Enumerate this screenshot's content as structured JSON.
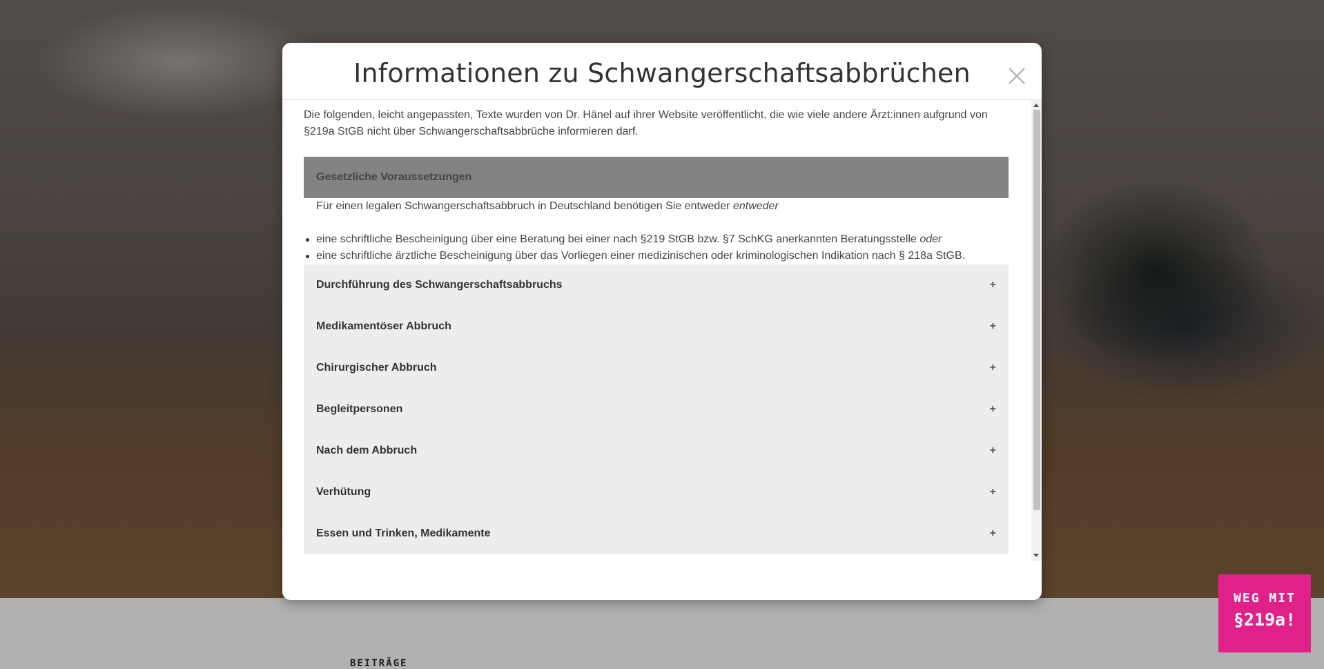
{
  "modal": {
    "title": "Informationen zu Schwangerschaftsabbrüchen",
    "intro": "Die folgenden, leicht angepassten, Texte wurden von Dr. Hänel auf ihrer Website veröffentlicht, die wie viele andere Ärzt:innen aufgrund von §219a StGB nicht über Schwangerschaftsabbrüche informieren darf.",
    "open_section": {
      "title": "Gesetzliche Voraussetzungen",
      "toggle": "–",
      "text": "Für einen legalen Schwangerschaftsabbruch in Deutschland benötigen Sie entweder",
      "text_em": "entweder",
      "bullets": [
        {
          "text": "eine schriftliche Bescheinigung über eine Beratung bei einer nach §219 StGB bzw. §7 SchKG anerkannten Beratungsstelle",
          "em": "oder"
        },
        {
          "text": "eine schriftliche ärztliche Bescheinigung über das Vorliegen einer medizinischen oder kriminologischen Indikation nach § 218a StGB.",
          "em": ""
        }
      ]
    },
    "sections": [
      {
        "title": "Durchführung des Schwangerschaftsabbruchs",
        "toggle": "+"
      },
      {
        "title": "Medikamentöser Abbruch",
        "toggle": "+"
      },
      {
        "title": "Chirurgischer Abbruch",
        "toggle": "+"
      },
      {
        "title": "Begleitpersonen",
        "toggle": "+"
      },
      {
        "title": "Nach dem Abbruch",
        "toggle": "+"
      },
      {
        "title": "Verhütung",
        "toggle": "+"
      },
      {
        "title": "Essen und Trinken, Medikamente",
        "toggle": "+"
      }
    ]
  },
  "footer": {
    "heading": "BEITRÄGE"
  },
  "badge": {
    "line1": "WEG MIT",
    "line2": "§219a!",
    "color": "#e0218a"
  }
}
